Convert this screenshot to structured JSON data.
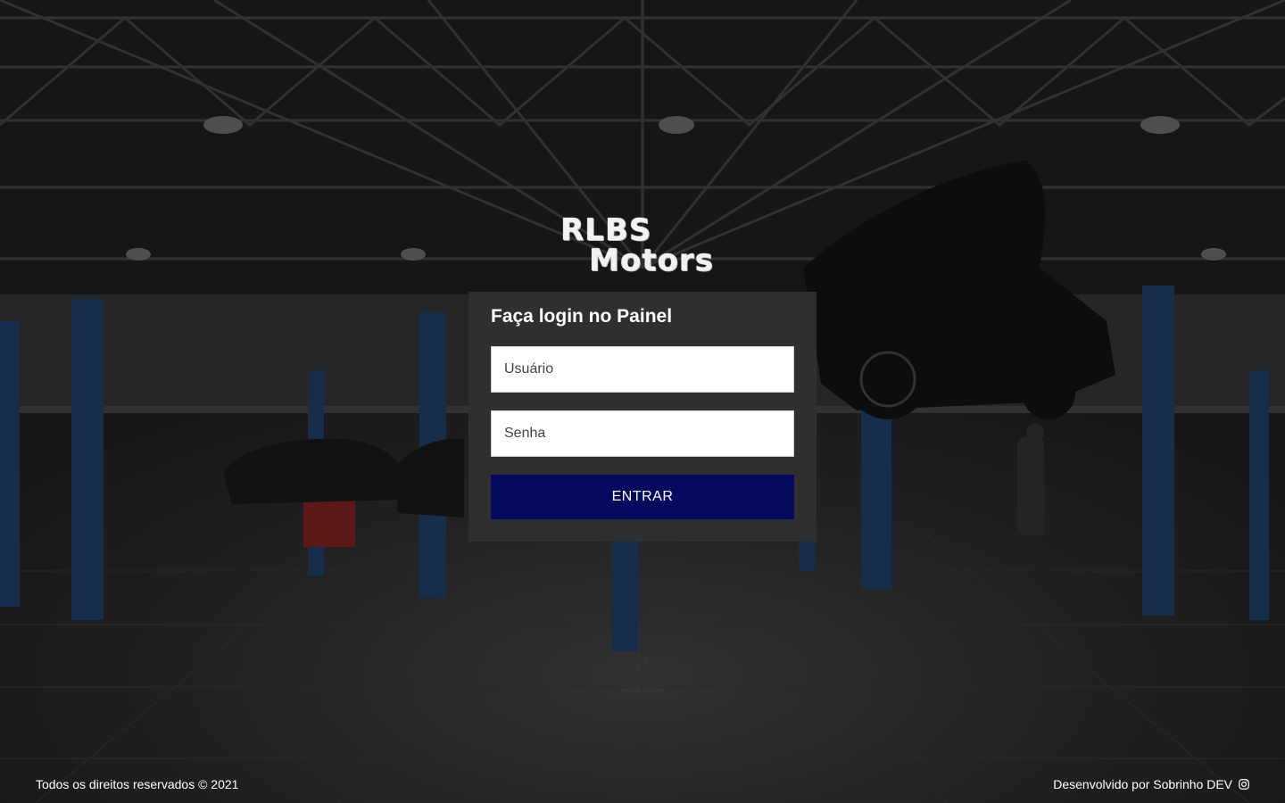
{
  "brand": {
    "line1": "RLBS",
    "line2": "Motors"
  },
  "login": {
    "title": "Faça login no Painel",
    "username_placeholder": "Usuário",
    "password_placeholder": "Senha",
    "submit_label": "ENTRAR"
  },
  "footer": {
    "copyright": "Todos os direitos reservados © 2021",
    "credit": "Desenvolvido por Sobrinho DEV",
    "credit_icon": "instagram-icon"
  },
  "colors": {
    "card_background": "#2f2f2f",
    "button_background": "#040a5e",
    "text": "#ffffff"
  }
}
